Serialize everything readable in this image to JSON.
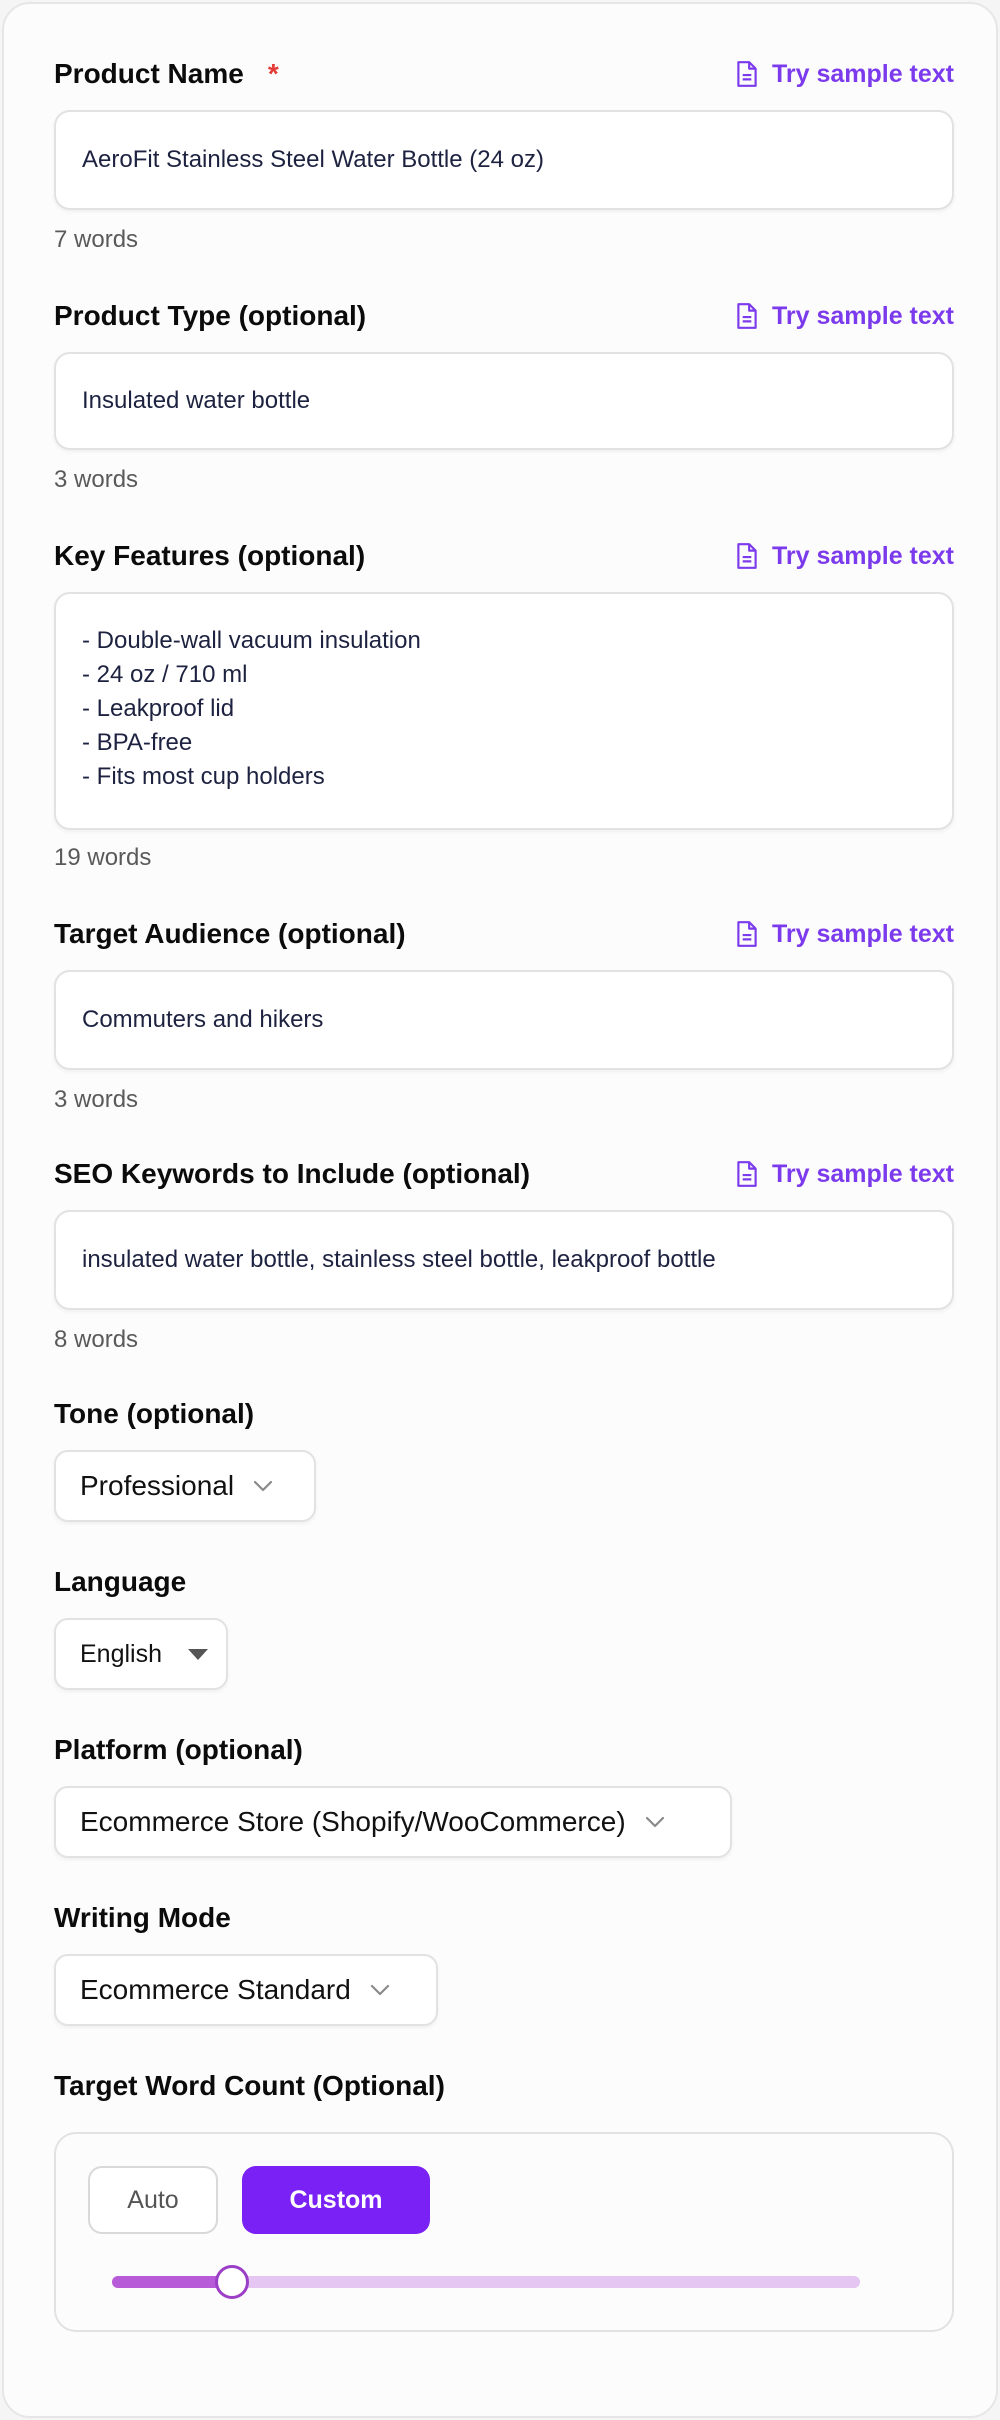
{
  "fields": {
    "product_name": {
      "label": "Product Name",
      "required_mark": "*",
      "value": "AeroFit Stainless Steel Water Bottle (24 oz)",
      "count": "7 words"
    },
    "product_type": {
      "label": "Product Type (optional)",
      "value": "Insulated water bottle",
      "count": "3 words"
    },
    "key_features": {
      "label": "Key Features (optional)",
      "lines": [
        "- Double-wall vacuum insulation",
        "- 24 oz / 710 ml",
        "- Leakproof lid",
        "- BPA-free",
        "- Fits most cup holders"
      ],
      "count": "19 words"
    },
    "target_audience": {
      "label": "Target Audience (optional)",
      "value": "Commuters and hikers",
      "count": "3 words"
    },
    "seo_keywords": {
      "label": "SEO Keywords to Include (optional)",
      "value": "insulated water bottle, stainless steel bottle, leakproof bottle",
      "count": "8 words"
    }
  },
  "sample_link": {
    "label": "Try sample text",
    "icon": "document-icon"
  },
  "tone": {
    "label": "Tone (optional)",
    "selected": "Professional"
  },
  "language": {
    "label": "Language",
    "selected": "English"
  },
  "platform": {
    "label": "Platform (optional)",
    "selected": "Ecommerce Store (Shopify/WooCommerce)"
  },
  "writing_mode": {
    "label": "Writing Mode",
    "selected": "Ecommerce Standard"
  },
  "word_count": {
    "label": "Target Word Count (Optional)",
    "auto_label": "Auto",
    "custom_label": "Custom",
    "mode": "Custom",
    "slider_fraction": 0.16
  },
  "colors": {
    "accent": "#7a22f5",
    "link": "#7c3aed",
    "required": "#e53935",
    "slider_fill": "#b85bd8",
    "slider_track": "#e5c6f2"
  }
}
